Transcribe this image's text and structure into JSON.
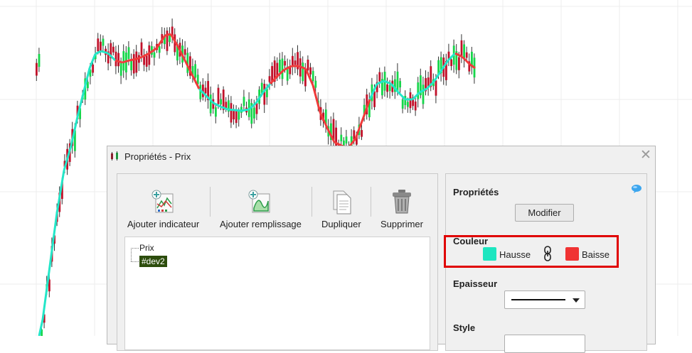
{
  "dialog": {
    "title": "Propriétés - Prix",
    "close_glyph": "✕",
    "toolbar": {
      "add_indicator": "Ajouter indicateur",
      "add_fill": "Ajouter remplissage",
      "duplicate": "Dupliquer",
      "delete": "Supprimer"
    },
    "tree": {
      "root": "Prix",
      "child": "#dev2"
    },
    "properties": {
      "heading": "Propriétés",
      "modify_button": "Modifier",
      "color_heading": "Couleur",
      "up_label": "Hausse",
      "down_label": "Baisse",
      "thickness_heading": "Epaisseur",
      "style_heading": "Style"
    }
  },
  "icons": [
    "app-chart-icon",
    "add-indicator-icon",
    "add-fill-icon",
    "duplicate-icon",
    "trash-icon",
    "help-bubble-icon",
    "link-icon",
    "close-icon"
  ],
  "colors": {
    "up_candle": "#16d64a",
    "down_candle": "#c1112a",
    "hausse": "#1de6c0",
    "baisse": "#f03333",
    "indicator_up": "#23e6c8",
    "indicator_down": "#f03a3a",
    "highlight": "#e00000",
    "selection": "#2d4d0d"
  },
  "chart_data": {
    "type": "candlestick",
    "grid": true,
    "indicator_trend": [
      "up",
      "up",
      "up",
      "up",
      "up",
      "up",
      "up",
      "up",
      "up",
      "up",
      "up",
      "up",
      "down",
      "down",
      "down",
      "down",
      "down",
      "down",
      "down",
      "down",
      "down",
      "down",
      "down",
      "down",
      "up",
      "up",
      "up",
      "up",
      "up",
      "up",
      "up",
      "up",
      "up",
      "up",
      "down",
      "down",
      "down",
      "down",
      "down",
      "down",
      "down",
      "down",
      "down",
      "down",
      "down",
      "down",
      "down",
      "down",
      "up",
      "up",
      "up",
      "up",
      "up",
      "up",
      "up",
      "up",
      "up",
      "up",
      "up",
      "up",
      "down",
      "down",
      "down",
      "down",
      "up",
      "up",
      "up",
      "up",
      "up",
      "down",
      "down",
      "down"
    ]
  }
}
